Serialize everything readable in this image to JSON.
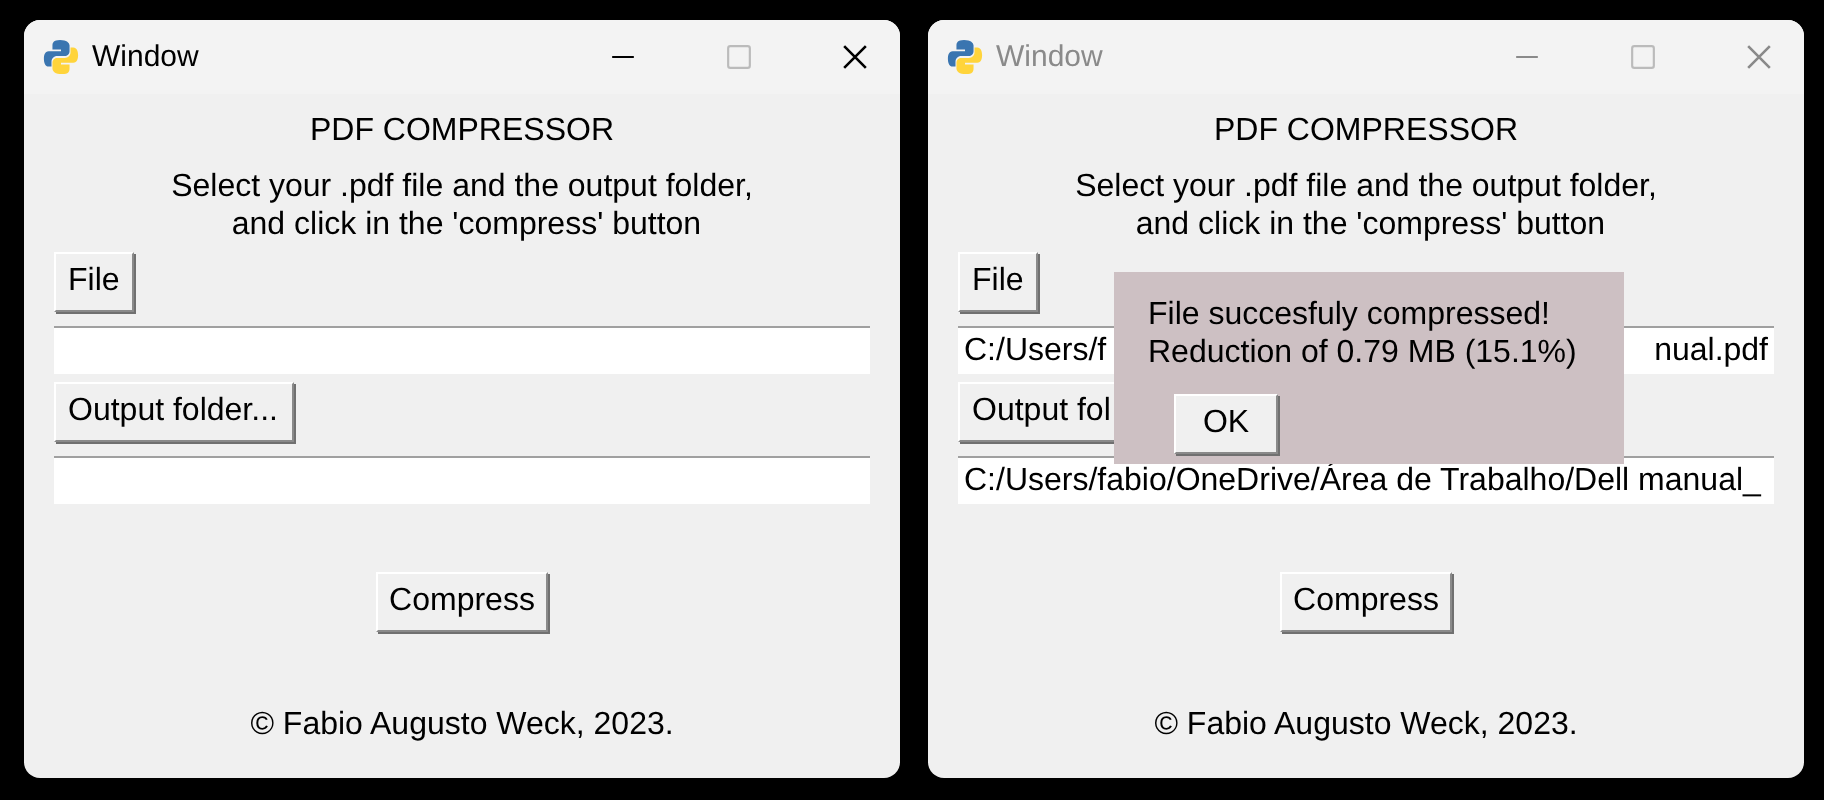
{
  "windows": [
    {
      "title": "Window",
      "active": true,
      "header": "PDF COMPRESSOR",
      "instructions": [
        "Select your .pdf file and the output folder,",
        " and click in the 'compress' button"
      ],
      "file_button": "File",
      "output_button": "Output folder...",
      "compress_button": "Compress",
      "footer": "© Fabio Augusto Weck, 2023."
    },
    {
      "title": "Window",
      "active": false,
      "header": "PDF COMPRESSOR",
      "instructions": [
        "Select your .pdf file and the output folder,",
        " and click in the 'compress' button"
      ],
      "file_button": "File",
      "file_path": [
        "C:/Users/f",
        "nual.pdf"
      ],
      "output_button": "Output fol",
      "output_path": [
        "C:/Users/fabio/OneDrive/Área de Trabalho/Dell manual_"
      ],
      "compress_button": "Compress",
      "footer": "© Fabio Augusto Weck, 2023.",
      "popup": {
        "lines": [
          "File succesfuly compressed!",
          "Reduction of 0.79 MB (15.1%)"
        ],
        "button": "OK"
      }
    }
  ]
}
